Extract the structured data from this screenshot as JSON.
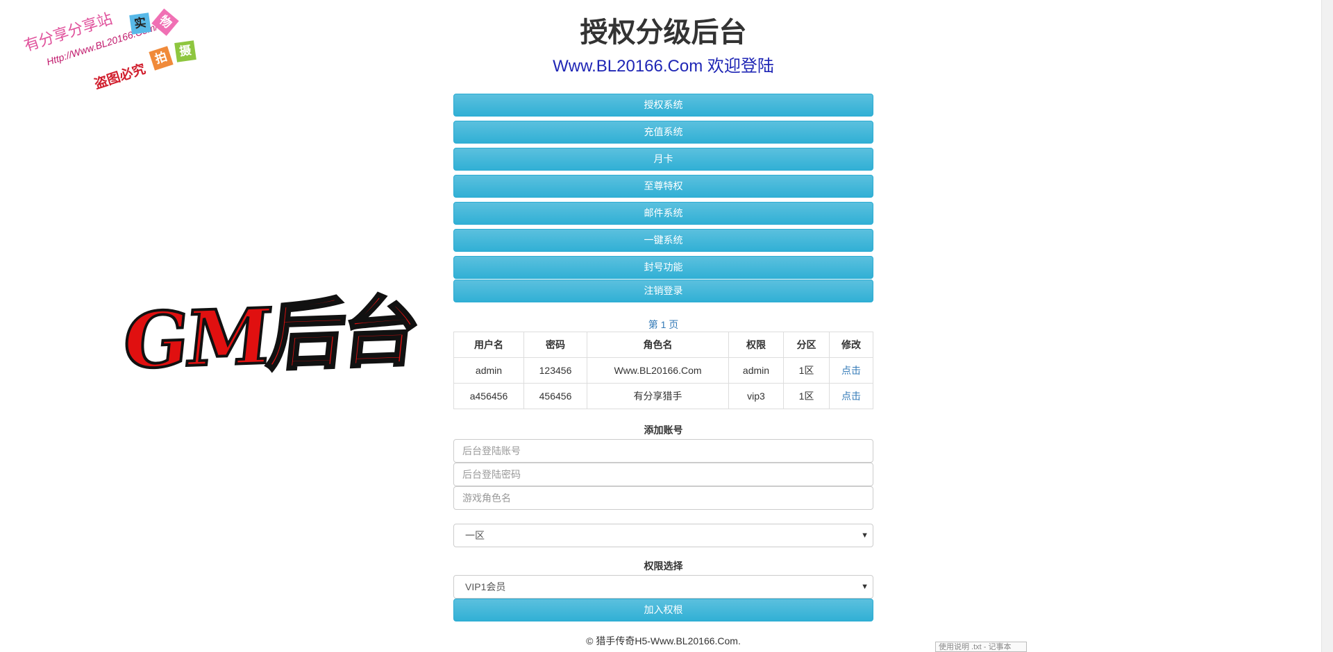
{
  "watermark": {
    "line1": "有分享分享站",
    "line2": "Http://Www.BL20166.Com/",
    "line3": "盗图必究",
    "tags": [
      "实",
      "物",
      "拍",
      "摄"
    ]
  },
  "logo": {
    "text": "GM后台"
  },
  "header": {
    "title": "授权分级后台",
    "welcome": "Www.BL20166.Com 欢迎登陆"
  },
  "menu": {
    "items": [
      "授权系统",
      "充值系统",
      "月卡",
      "至尊特权",
      "邮件系统",
      "一键系统",
      "封号功能",
      "注销登录"
    ]
  },
  "table": {
    "page_label": "第 1 页",
    "columns": [
      "用户名",
      "密码",
      "角色名",
      "权限",
      "分区",
      "修改"
    ],
    "rows": [
      [
        "admin",
        "123456",
        "Www.BL20166.Com",
        "admin",
        "1区",
        "点击"
      ],
      [
        "a456456",
        "456456",
        "有分享猎手",
        "vip3",
        "1区",
        "点击"
      ]
    ]
  },
  "add_account": {
    "heading": "添加账号",
    "username_placeholder": "后台登陆账号",
    "password_placeholder": "后台登陆密码",
    "role_placeholder": "游戏角色名",
    "zone_value": "一区",
    "permission_heading": "权限选择",
    "permission_value": "VIP1会员",
    "submit_label": "加入权根"
  },
  "footer": {
    "text": "© 猎手传奇H5-Www.BL20166.Com."
  },
  "statusbar": {
    "text": "使用说明 .txt - 记事本"
  },
  "colors": {
    "accent": "#5bc0de",
    "link": "#337ab7",
    "welcome": "#1f26b5",
    "logo": "#e01010"
  }
}
